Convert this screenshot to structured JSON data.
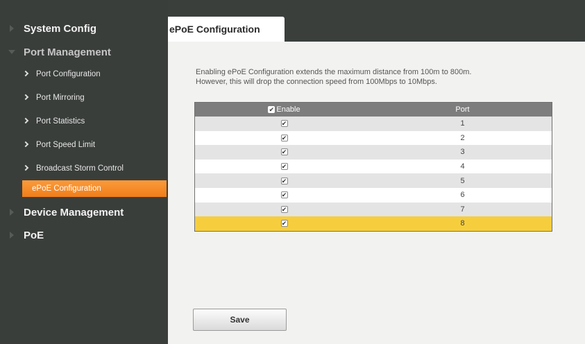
{
  "sidebar": {
    "system_config": "System Config",
    "port_management": "Port Management",
    "sub_items": [
      "Port Configuration",
      "Port Mirroring",
      "Port Statistics",
      "Port Speed Limit",
      "Broadcast Storm Control",
      "ePoE Configuration"
    ],
    "device_management": "Device Management",
    "poe": "PoE"
  },
  "page": {
    "tab_title": "ePoE Configuration",
    "description_line1": "Enabling ePoE Configuration extends the maximum distance from 100m to 800m.",
    "description_line2": "However, this will drop the connection speed from 100Mbps to 10Mbps."
  },
  "table": {
    "header_enable": "Enable",
    "header_port": "Port",
    "check_mark": "✔",
    "ports": [
      "1",
      "2",
      "3",
      "4",
      "5",
      "6",
      "7",
      "8"
    ]
  },
  "buttons": {
    "save": "Save"
  },
  "colors": {
    "active_nav": "#f07d19",
    "selected_row": "#f6ce3d",
    "sidebar_bg": "#3a3e3b",
    "table_header": "#7d7d7d"
  }
}
